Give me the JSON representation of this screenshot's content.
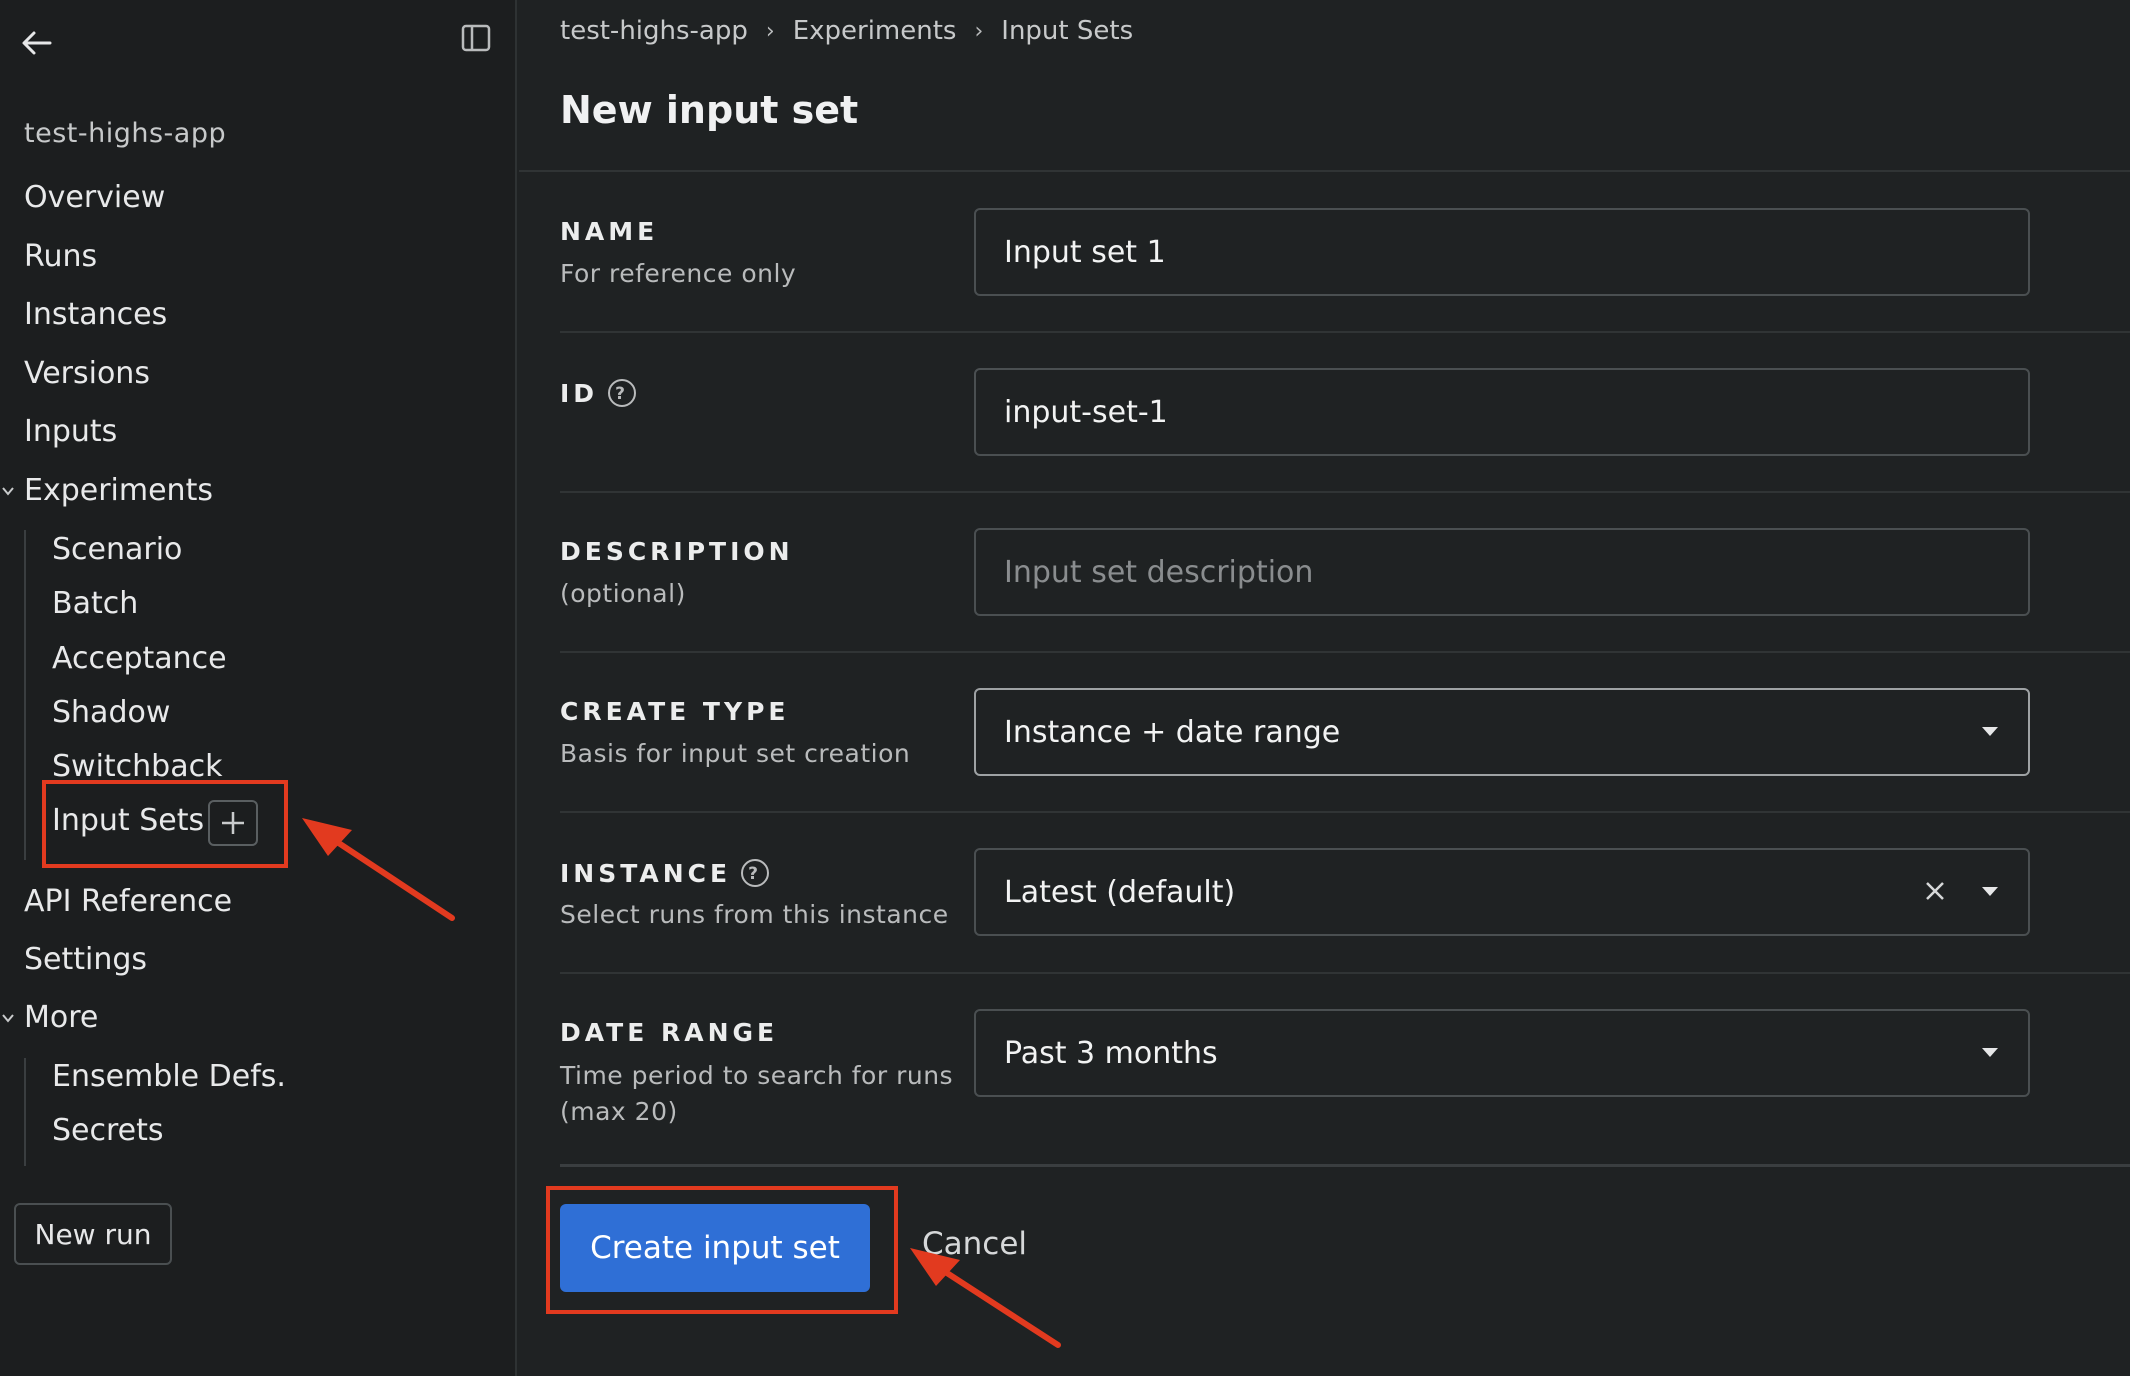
{
  "sidebar": {
    "app_name": "test-highs-app",
    "nav": {
      "overview": "Overview",
      "runs": "Runs",
      "instances": "Instances",
      "versions": "Versions",
      "inputs": "Inputs",
      "experiments": "Experiments",
      "scenario": "Scenario",
      "batch": "Batch",
      "acceptance": "Acceptance",
      "shadow": "Shadow",
      "switchback": "Switchback",
      "input_sets": "Input Sets",
      "api_reference": "API Reference",
      "settings": "Settings",
      "more": "More",
      "ensemble_defs": "Ensemble Defs.",
      "secrets": "Secrets"
    },
    "new_run_label": "New run"
  },
  "breadcrumb": [
    "test-highs-app",
    "Experiments",
    "Input Sets"
  ],
  "page_title": "New input set",
  "form": {
    "name": {
      "label": "NAME",
      "help": "For reference only",
      "value": "Input set 1"
    },
    "id": {
      "label": "ID",
      "value": "input-set-1"
    },
    "description": {
      "label": "DESCRIPTION",
      "help": "(optional)",
      "placeholder": "Input set description"
    },
    "create_type": {
      "label": "CREATE TYPE",
      "help": "Basis for input set creation",
      "value": "Instance + date range"
    },
    "instance": {
      "label": "INSTANCE",
      "help": "Select runs from this instance",
      "value": "Latest (default)"
    },
    "date_range": {
      "label": "DATE RANGE",
      "help_line1": "Time period to search for runs",
      "help_line2": "(max 20)",
      "value": "Past 3 months"
    }
  },
  "actions": {
    "create_label": "Create input set",
    "cancel_label": "Cancel"
  },
  "colors": {
    "background": "#1f2223",
    "sidebar": "#1c1e1f",
    "primary_button": "#2f6fd6",
    "annotation": "#e23a1f"
  },
  "icons": [
    "back-arrow-icon",
    "sidebar-toggle-icon",
    "chevron-down-icon",
    "plus-icon",
    "help-icon",
    "caret-down-icon",
    "close-icon"
  ]
}
